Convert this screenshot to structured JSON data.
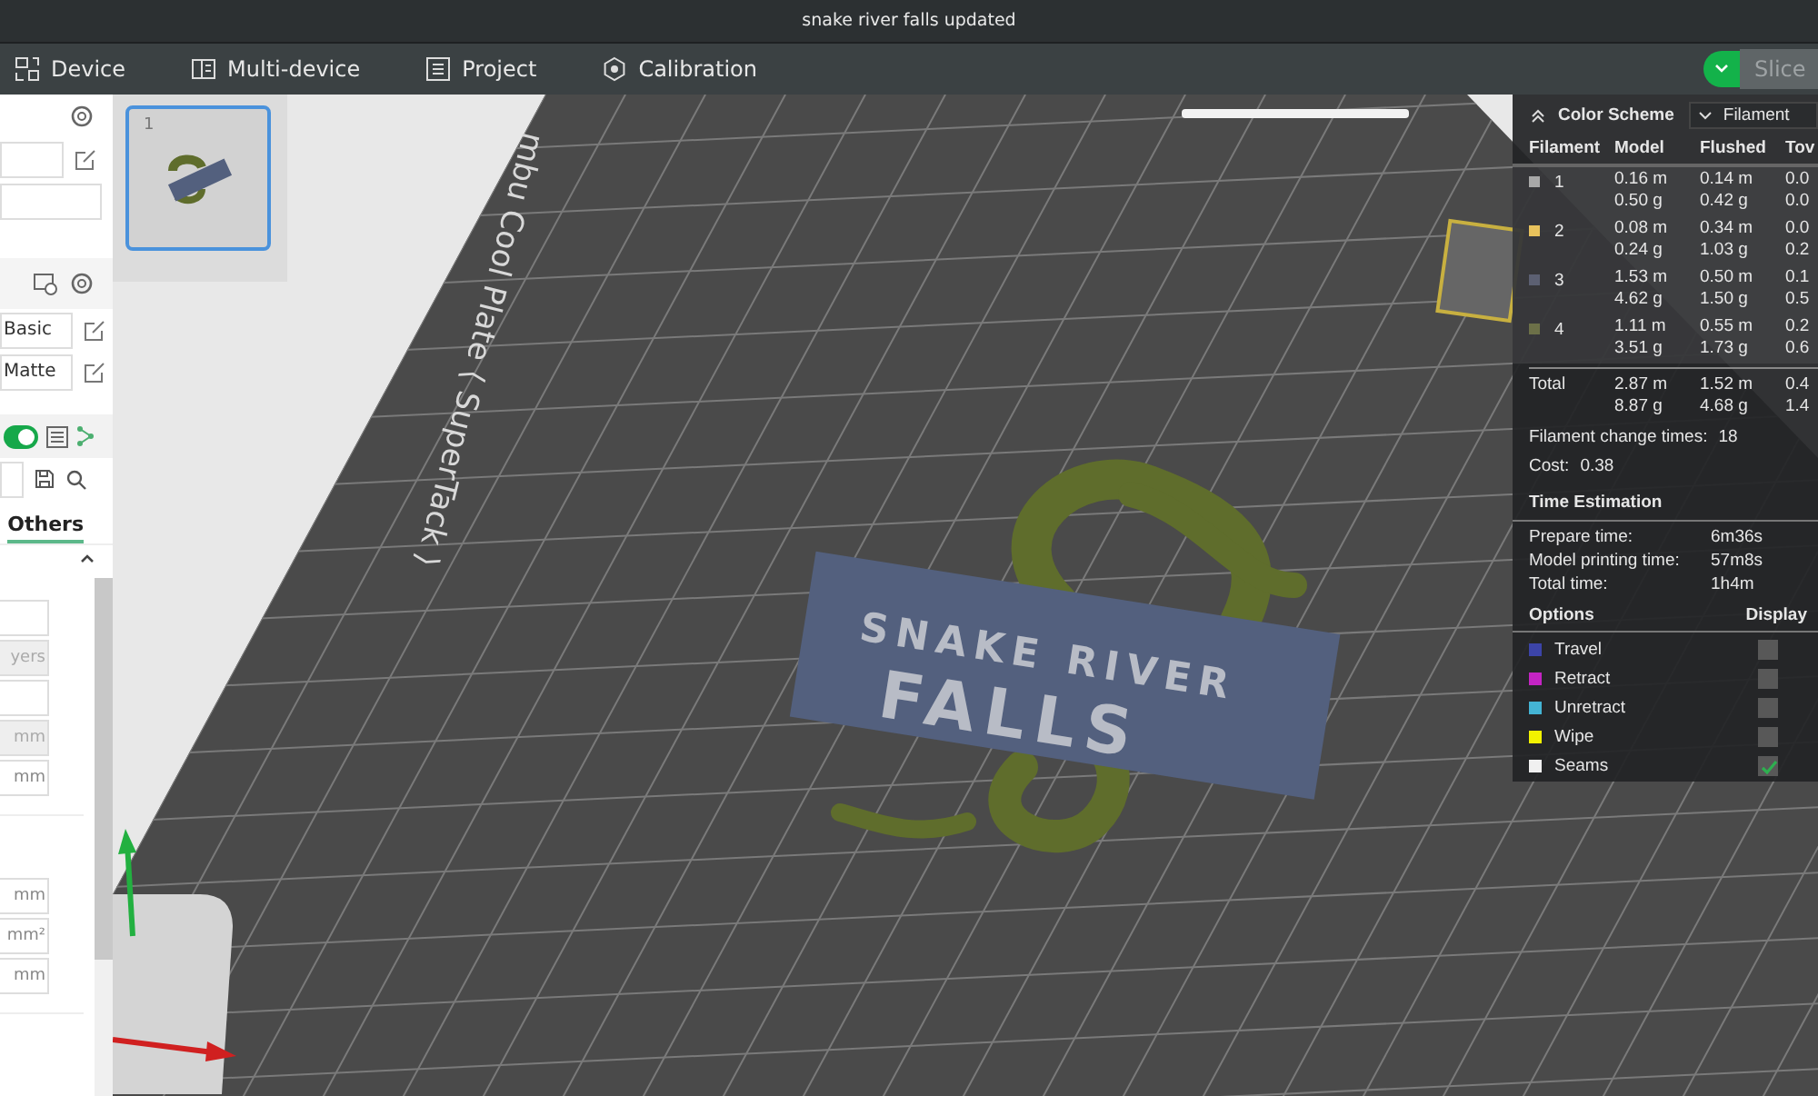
{
  "window": {
    "title": "snake river falls updated"
  },
  "menu": [
    {
      "label": "Device"
    },
    {
      "label": "Multi-device"
    },
    {
      "label": "Project"
    },
    {
      "label": "Calibration"
    }
  ],
  "slice_button": {
    "label": "Slice",
    "disabled": true
  },
  "left_panel": {
    "presets": [
      {
        "value": "Basic"
      },
      {
        "value": "Matte"
      }
    ],
    "toggle": {
      "on": true
    },
    "tab": {
      "label": "Others",
      "selected": true
    },
    "fields": [
      {
        "kind": "blank",
        "disabled": false
      },
      {
        "kind": "unit",
        "text": "yers",
        "disabled": true
      },
      {
        "kind": "blank",
        "disabled": false
      },
      {
        "kind": "unit",
        "text": "mm",
        "disabled": true
      },
      {
        "kind": "unit",
        "text": "mm",
        "disabled": false
      }
    ],
    "fields_2": [
      {
        "kind": "unit",
        "text": "mm",
        "disabled": false
      },
      {
        "kind": "unit",
        "text": "mm²",
        "disabled": false
      },
      {
        "kind": "unit",
        "text": "mm",
        "disabled": false
      }
    ]
  },
  "plates": [
    {
      "number": "1",
      "selected": true
    }
  ],
  "bed": {
    "label": "mbu Cool Plate ⟨ SuperTack ⟩"
  },
  "model": {
    "lines": [
      "SNAKE RIVER",
      "FALLS"
    ]
  },
  "legend": {
    "title": "Color Scheme",
    "scheme": "Filament",
    "columns": [
      "Filament",
      "Model",
      "Flushed",
      "Tov"
    ],
    "rows": [
      {
        "id": "1",
        "color": "#a8a8a8",
        "model": [
          "0.16 m",
          "0.50 g"
        ],
        "flushed": [
          "0.14 m",
          "0.42 g"
        ],
        "column_4": [
          "0.0",
          "0.0"
        ]
      },
      {
        "id": "2",
        "color": "#e8c25c",
        "model": [
          "0.08 m",
          "0.24 g"
        ],
        "flushed": [
          "0.34 m",
          "1.03 g"
        ],
        "column_4": [
          "0.0",
          "0.2"
        ]
      },
      {
        "id": "3",
        "color": "#5c6072",
        "model": [
          "1.53 m",
          "4.62 g"
        ],
        "flushed": [
          "0.50 m",
          "1.50 g"
        ],
        "column_4": [
          "0.1",
          "0.5"
        ]
      },
      {
        "id": "4",
        "color": "#6c7048",
        "model": [
          "1.11 m",
          "3.51 g"
        ],
        "flushed": [
          "0.55 m",
          "1.73 g"
        ],
        "column_4": [
          "0.2",
          "0.6"
        ]
      }
    ],
    "total": {
      "label": "Total",
      "model": [
        "2.87 m",
        "8.87 g"
      ],
      "flushed": [
        "1.52 m",
        "4.68 g"
      ],
      "column_4": [
        "0.4",
        "1.4"
      ]
    },
    "change_times": {
      "label": "Filament change times:",
      "value": "18"
    },
    "cost": {
      "label": "Cost:",
      "value": "0.38"
    },
    "time_title": "Time Estimation",
    "times": [
      {
        "label": "Prepare time:",
        "value": "6m36s"
      },
      {
        "label": "Model printing time:",
        "value": "57m8s"
      },
      {
        "label": "Total time:",
        "value": "1h4m"
      }
    ],
    "options_title": "Options",
    "display_title": "Display",
    "options": [
      {
        "label": "Travel",
        "color": "#3c44a8",
        "checked": false
      },
      {
        "label": "Retract",
        "color": "#c424c4",
        "checked": false
      },
      {
        "label": "Unretract",
        "color": "#44b4d4",
        "checked": false
      },
      {
        "label": "Wipe",
        "color": "#f2f200",
        "checked": false
      },
      {
        "label": "Seams",
        "color": "#f0f0f0",
        "checked": true
      }
    ]
  }
}
